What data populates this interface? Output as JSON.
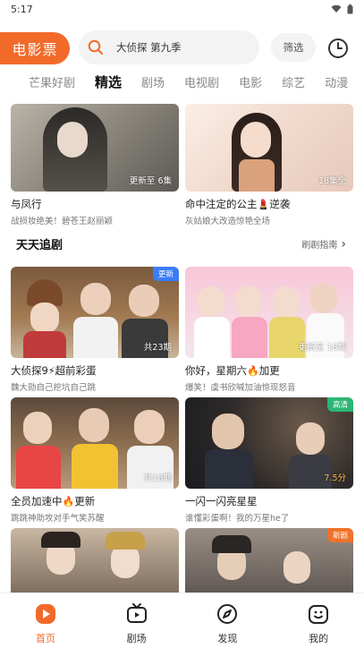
{
  "status": {
    "time": "5:17"
  },
  "header": {
    "brand": "电影票",
    "search_placeholder": "大侦探 第九季",
    "filter_label": "筛选"
  },
  "tabs": [
    {
      "label": "芒果好剧"
    },
    {
      "label": "精选"
    },
    {
      "label": "剧场"
    },
    {
      "label": "电视剧"
    },
    {
      "label": "电影"
    },
    {
      "label": "综艺"
    },
    {
      "label": "动漫"
    }
  ],
  "top_cards": [
    {
      "title": "与凤行",
      "subtitle": "战损妆绝美！碧苍王赵丽颖",
      "badge": "更新至 6集"
    },
    {
      "title": "命中注定的公主",
      "title_suffix": "逆袭",
      "subtitle": "灰姑娘大改造惊艳全场",
      "badge": "18集全"
    }
  ],
  "section": {
    "title": "天天追剧",
    "link": "刷剧指南"
  },
  "grid_cards": [
    {
      "title": "大侦探9",
      "title_suffix": "超前彩蛋",
      "subtitle": "魏大勋自己挖坑自己跳",
      "badge": "共23期",
      "tag": "更新",
      "tag_color": "#3b7cf5"
    },
    {
      "title": "你好，星期六",
      "title_suffix": "加更",
      "subtitle": "爆笑！虞书欣喊加油惊现怒音",
      "badge": "更新至 18期",
      "tag": "",
      "tag_color": ""
    },
    {
      "title": "全员加速中",
      "title_suffix": "更新",
      "subtitle": "跳跳神助攻对手气笑苏醒",
      "badge": "共18期",
      "tag": "",
      "tag_color": ""
    },
    {
      "title": "一闪一闪亮星星",
      "subtitle": "谁懂彩蛋啊！我的万星he了",
      "badge": "7.5分",
      "badge_color": "#ffb74d",
      "tag": "高清",
      "tag_color": "#2bb673"
    },
    {
      "title": "",
      "subtitle": "",
      "badge": "",
      "tag": "",
      "tag_color": ""
    },
    {
      "title": "",
      "subtitle": "",
      "badge": "",
      "tag": "新剧",
      "tag_color": "#f0722a"
    }
  ],
  "nav": [
    {
      "label": "首页"
    },
    {
      "label": "剧场"
    },
    {
      "label": "发现"
    },
    {
      "label": "我的"
    }
  ],
  "colors": {
    "accent": "#f26a2a"
  }
}
